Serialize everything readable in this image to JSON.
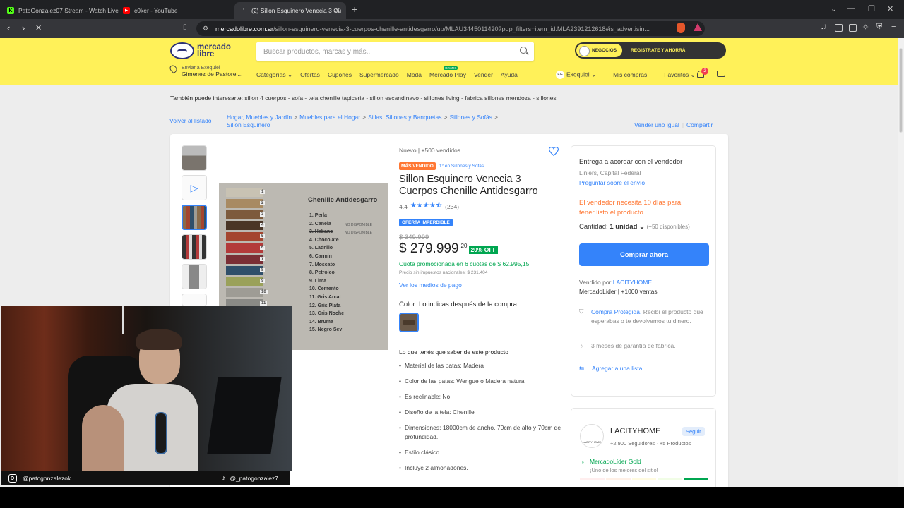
{
  "browser": {
    "tabs": [
      {
        "label": "PatoGonzalez07 Stream - Watch Live",
        "fav_color": "#53fc18",
        "fav_char": "K"
      },
      {
        "label": "c0ker - YouTube",
        "fav_color": "#ff0000",
        "fav_char": "▶"
      },
      {
        "label": "(2) Sillon Esquinero Venecia 3 Cu",
        "fav_color": "#999999",
        "fav_char": "'"
      }
    ],
    "new_tab": "+",
    "url_domain": "mercadolibre.com.ar",
    "url_path": "/sillon-esquinero-venecia-3-cuerpos-chenille-antidesgarro/up/MLAU3445011420?pdp_filters=item_id:MLA2391212618#is_advertisin..."
  },
  "header": {
    "logo_line1": "mercado",
    "logo_line2": "libre",
    "search_placeholder": "Buscar productos, marcas y más...",
    "promo_left": "NEGOCIOS",
    "promo_right": "REGISTRATE Y AHORRÁ",
    "loc_line1": "Enviar a Exequiel",
    "loc_line2": "Gimenez de Pastorel...",
    "nav": [
      "Categorías ⌄",
      "Ofertas",
      "Cupones",
      "Supermercado",
      "Moda",
      "Mercado Play",
      "Vender",
      "Ayuda"
    ],
    "avatar_initials": "EG",
    "user": "Exequiel ⌄",
    "my_purchases": "Mis compras",
    "favorites": "Favoritos ⌄",
    "notif_count": "2"
  },
  "interest": {
    "label": "También puede interesarte:",
    "items": "sillon 4 cuerpos - sofa - tela chenille tapiceria - sillon escandinavo - sillones living - fabrica sillones mendoza - sillones"
  },
  "breadcrumb": {
    "back": "Volver al listado",
    "items": [
      "Hogar, Muebles y Jardín",
      "Muebles para el Hogar",
      "Sillas, Sillones y Banquetas",
      "Sillones y Sofás",
      "Sillon Esquinero"
    ],
    "sell_same": "Vender uno igual",
    "share": "Compartir"
  },
  "product": {
    "condition": "Nuevo  |  +500 vendidos",
    "best_seller_tag": "MÁS VENDIDO",
    "rank": "1° en Sillones y Sofás",
    "title": "Sillon Esquinero Venecia 3 Cuerpos Chenille Antidesgarro",
    "rating_value": "4.4",
    "rating_stars": 4.4,
    "rating_count": "(234)",
    "deal_tag": "OFERTA IMPERDIBLE",
    "old_price": "$ 349.999",
    "price": "$ 279.999",
    "price_cents": "20",
    "discount": "20% OFF",
    "installments": "Cuota promocionada en 6 cuotas de $ 62.995,15",
    "tax_note": "Precio sin impuestos nacionales: $ 231.404",
    "payment_link": "Ver los medios de pago",
    "color_label": "Color:",
    "color_value": "Lo indicas después de la compra",
    "know_title": "Lo que tenés que saber de este producto",
    "features": [
      "Material de las patas: Madera",
      "Color de las patas: Wengue o Madera natural",
      "Es reclinable: No",
      "Diseño de la tela: Chenille",
      "Dimensiones: 18000cm de ancho, 70cm de alto y 70cm de profundidad.",
      "Estilo clásico.",
      "Incluye 2 almohadones."
    ]
  },
  "swatch_card": {
    "title": "Chenille Antidesgarro",
    "items": [
      {
        "n": "1",
        "name": "1. Perla",
        "color": "#c8c2b3",
        "nd": ""
      },
      {
        "n": "2",
        "name": "2. Canela",
        "color": "#a88a62",
        "nd": "NO DISPONIBLE"
      },
      {
        "n": "3",
        "name": "3. Habano",
        "color": "#7d5a3c",
        "nd": "NO DISPONIBLE"
      },
      {
        "n": "4",
        "name": "4. Chocolate",
        "color": "#4a3526",
        "nd": ""
      },
      {
        "n": "5",
        "name": "5. Ladrillo",
        "color": "#a4452f",
        "nd": ""
      },
      {
        "n": "6",
        "name": "6. Carmin",
        "color": "#b33a3a",
        "nd": ""
      },
      {
        "n": "7",
        "name": "7. Moscato",
        "color": "#7a2e35",
        "nd": ""
      },
      {
        "n": "8",
        "name": "8. Petróleo",
        "color": "#2f4f6a",
        "nd": ""
      },
      {
        "n": "9",
        "name": "9. Lima",
        "color": "#9aa15a",
        "nd": ""
      },
      {
        "n": "10",
        "name": "10. Cemento",
        "color": "#9e9c95",
        "nd": ""
      },
      {
        "n": "11",
        "name": "11. Gris Arcat",
        "color": "#8a8a86",
        "nd": ""
      },
      {
        "n": "12",
        "name": "12. Gris Plata",
        "color": "#b1b0ab",
        "nd": ""
      },
      {
        "n": "13",
        "name": "13. Gris Noche",
        "color": "#55555a",
        "nd": ""
      },
      {
        "n": "14",
        "name": "14. Bruma",
        "color": "#6d7378",
        "nd": ""
      },
      {
        "n": "15",
        "name": "15. Negro Sev",
        "color": "#2a2a2c",
        "nd": ""
      }
    ]
  },
  "buybox": {
    "delivery": "Entrega a acordar con el vendedor",
    "location": "Liniers, Capital Federal",
    "ask_shipping": "Preguntar sobre el envío",
    "lead_time_1": "El vendedor necesita 10 días para",
    "lead_time_2": "tener listo el producto.",
    "qty_label": "Cantidad:",
    "qty_value": "1 unidad ⌄",
    "qty_avail": "(+50 disponibles)",
    "buy_now": "Comprar ahora",
    "sold_by": "Vendido por",
    "seller": "LACITYHOME",
    "seller_level": "MercadoLíder | +1000 ventas",
    "protected_link": "Compra Protegida.",
    "protected_text": "Recibí el producto que esperabas o te devolvemos tu dinero.",
    "warranty": "3 meses de garantía de fábrica.",
    "add_list": "Agregar a una lista"
  },
  "seller_card": {
    "name": "LACITYHOME",
    "logo_text": "LACITYHOME",
    "follow": "Seguir",
    "followers": "+2.900 Seguidores · +5 Productos",
    "level": "MercadoLíder Gold",
    "level_sub": "¡Uno de los mejores del sitio!"
  },
  "stream": {
    "instagram": "@patogonzalezok",
    "tiktok": "@_patogonzalez7"
  },
  "colors": {
    "brand_yellow": "#fff159",
    "accent_blue": "#3483fa",
    "success_green": "#00a650",
    "warning_orange": "#ff7733"
  }
}
